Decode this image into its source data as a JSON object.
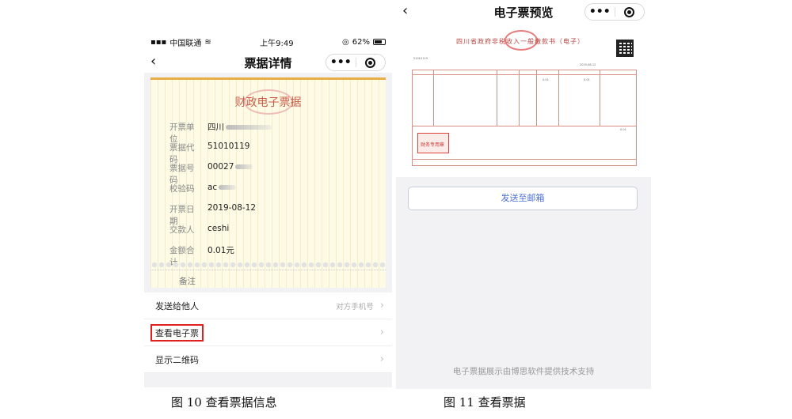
{
  "left_phone": {
    "status_bar": {
      "carrier": "中国联通",
      "time": "上午9:49",
      "battery": "62%"
    },
    "nav": {
      "title": "票据详情",
      "more_icon": "•••"
    },
    "receipt": {
      "title": "财政电子票据",
      "rows": [
        {
          "label": "开票单位",
          "value": "四川"
        },
        {
          "label": "票据代码",
          "value": "51010119"
        },
        {
          "label": "票据号码",
          "value": "00027"
        },
        {
          "label": "校验码",
          "value": "ac"
        },
        {
          "label": "开票日期",
          "value": "2019-08-12"
        },
        {
          "label": "交款人",
          "value": "ceshi"
        },
        {
          "label": "金额合计",
          "value": "0.01元"
        }
      ],
      "remark_label": "备注"
    },
    "menu": {
      "send_others": {
        "label": "发送给他人",
        "hint": "对方手机号"
      },
      "view_ebill": {
        "label": "查看电子票"
      },
      "show_qr": {
        "label": "显示二维码"
      }
    }
  },
  "right_phone": {
    "nav": {
      "title": "电子票预览",
      "more_icon": "•••"
    },
    "invoice": {
      "title": "四川省政府非税收入一般缴款书（电子）",
      "stamp_text": "财务专用章",
      "fields": {
        "code": "51010119",
        "date": "2019-08-12",
        "amount": "0.01"
      }
    },
    "send_email_label": "发送至邮箱",
    "footer_note": "电子票据展示由博思软件提供技术支持"
  },
  "captions": {
    "fig10": "图 10 查看票据信息",
    "fig11": "图 11 查看票据"
  },
  "colors": {
    "accent_orange": "#e8ae46",
    "title_red": "#cc5c4a",
    "link_blue": "#4a6fd6",
    "highlight_red": "#e02020"
  },
  "icons": [
    "back-icon",
    "more-icon",
    "target-icon",
    "chevron-right-icon",
    "wifi-icon",
    "signal-icon",
    "battery-icon"
  ]
}
